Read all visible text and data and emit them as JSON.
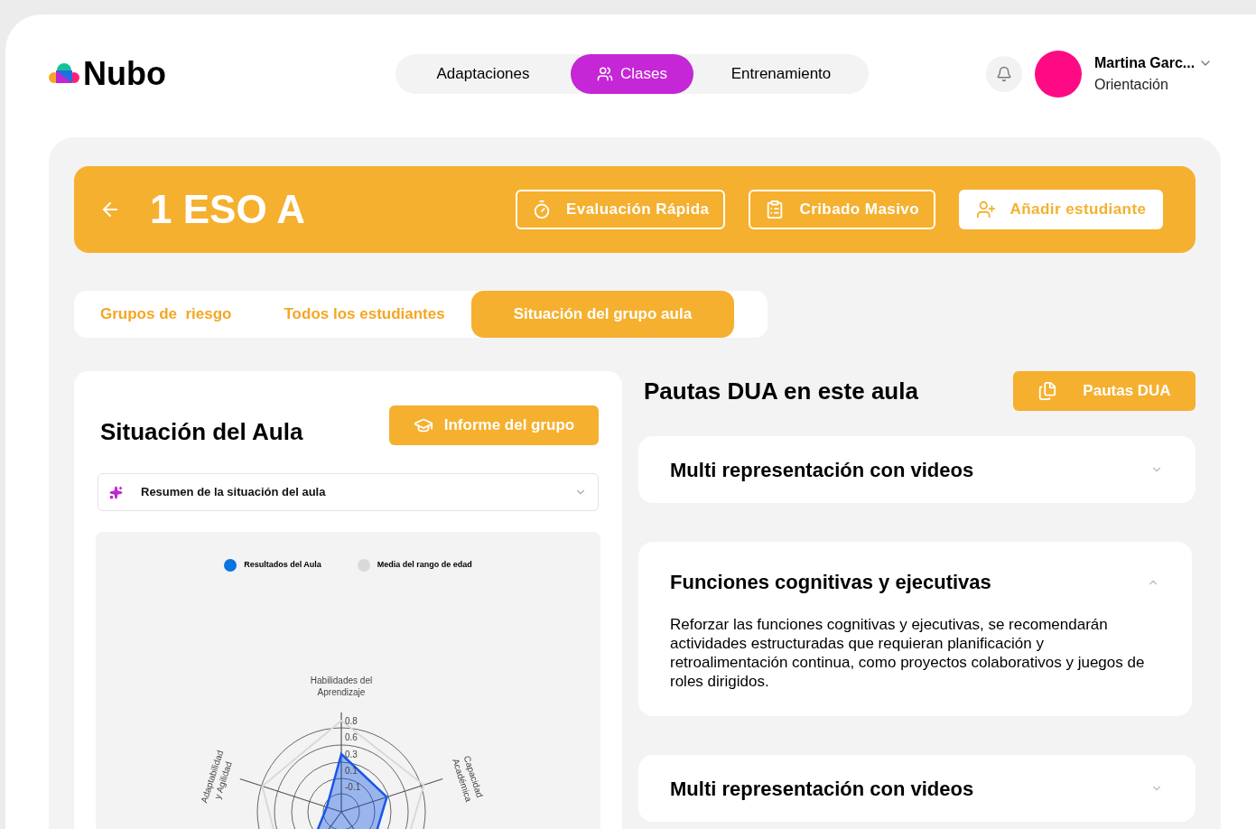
{
  "brand": {
    "name": "Nubo"
  },
  "nav": [
    {
      "label": "Adaptaciones",
      "selected": false
    },
    {
      "label": "Clases",
      "selected": true
    },
    {
      "label": "Entrenamiento",
      "selected": false
    }
  ],
  "user": {
    "name": "Martina Garc...",
    "role": "Orientación"
  },
  "header": {
    "title": "1 ESO A",
    "actions": [
      {
        "label": "Evaluación Rápida",
        "kind": "outline"
      },
      {
        "label": "Cribado Masivo",
        "kind": "outline"
      },
      {
        "label": "Añadir estudiante",
        "kind": "solid"
      }
    ]
  },
  "tabs": [
    {
      "label": "Grupos de  riesgo",
      "selected": false
    },
    {
      "label": "Todos los estudiantes",
      "selected": false
    },
    {
      "label": "Situación del grupo aula",
      "selected": true
    }
  ],
  "situacion": {
    "title": "Situación del Aula",
    "report_button": "Informe del grupo",
    "summary": "Resumen de la situación del aula",
    "legend": [
      {
        "label": "Resultados del Aula",
        "color": "#0a74e0"
      },
      {
        "label": "Media del rango de edad",
        "color": "#d9d9d9"
      }
    ],
    "axis_labels": [
      "Habilidades del\nAprendizaje",
      "Capacidad\nAcadémica",
      "Adaptabilidad\ny Agilidad"
    ],
    "ticks": [
      "0.8",
      "0.6",
      "0.3",
      "0.1",
      "-0.1"
    ]
  },
  "pautas": {
    "title": "Pautas DUA en este aula",
    "button": "Pautas DUA",
    "items": [
      {
        "title": "Multi representación con videos",
        "expanded": false
      },
      {
        "title": "Funciones cognitivas y ejecutivas",
        "expanded": true,
        "body": "Reforzar las funciones cognitivas y ejecutivas, se recomendarán actividades estructuradas que requieran planificación y retroalimentación continua, como proyectos colaborativos y juegos de roles dirigidos."
      },
      {
        "title": "Multi representación con videos",
        "expanded": false
      }
    ]
  }
}
